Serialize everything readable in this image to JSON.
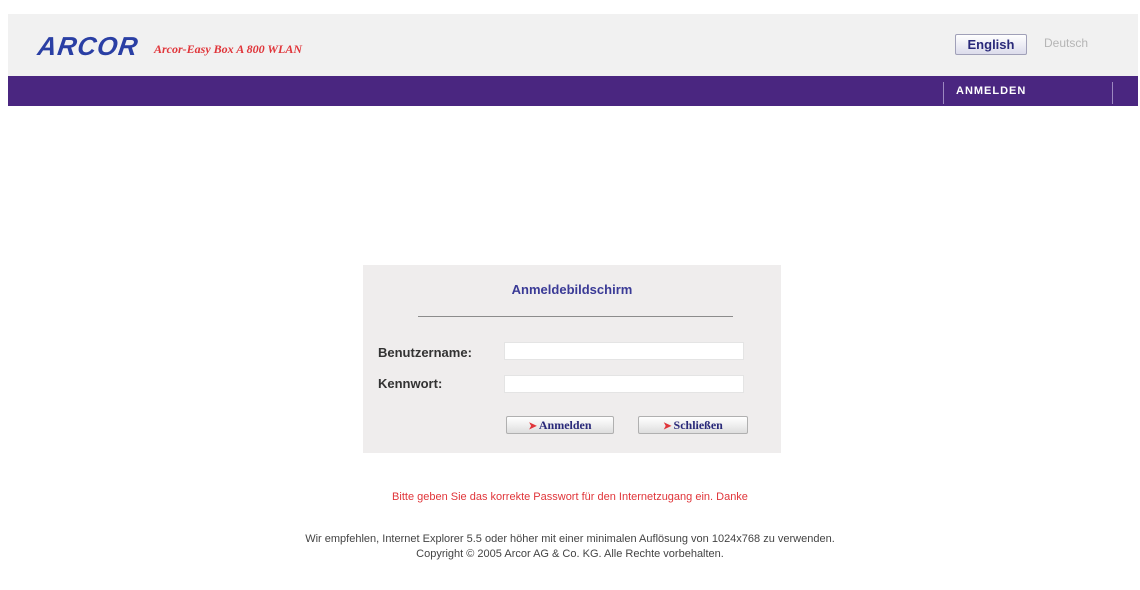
{
  "header": {
    "logo": "ARCOR",
    "product_name": "Arcor-Easy Box A 800 WLAN",
    "lang_english": "English",
    "lang_german": "Deutsch"
  },
  "nav": {
    "login_label": "ANMELDEN"
  },
  "login": {
    "title": "Anmeldebildschirm",
    "username_label": "Benutzername:",
    "username_value": "",
    "password_label": "Kennwort:",
    "password_value": "",
    "login_button": "Anmelden",
    "close_button": "Schließen"
  },
  "warning_text": "Bitte geben Sie das korrekte Passwort für den Internetzugang ein. Danke",
  "footer": {
    "recommendation": "Wir empfehlen, Internet Explorer 5.5 oder höher mit einer minimalen Auflösung von 1024x768 zu verwenden.",
    "copyright": "Copyright © 2005 Arcor AG & Co. KG. Alle Rechte vorbehalten."
  },
  "colors": {
    "nav_purple": "#4a2680",
    "accent_red": "#e0353a",
    "title_blue": "#3a3a96"
  }
}
